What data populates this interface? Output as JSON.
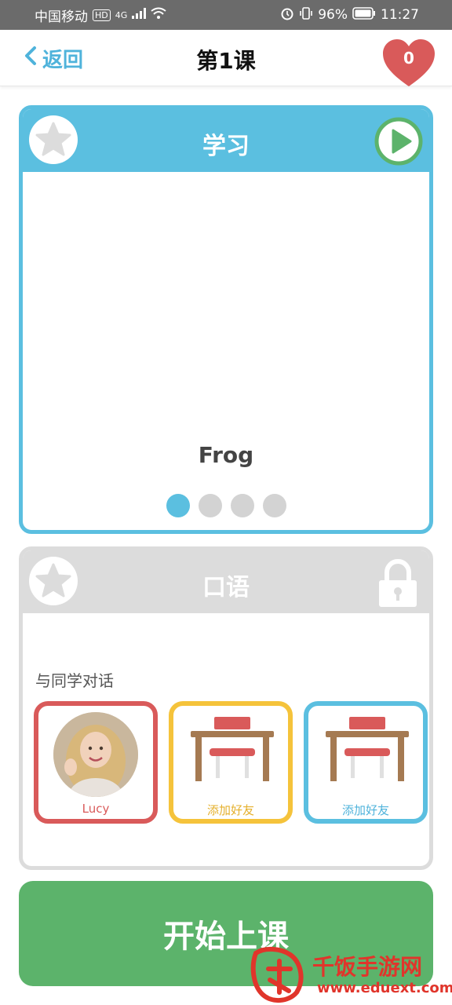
{
  "status_bar": {
    "carrier": "中国移动",
    "hd": "HD",
    "network": "4G",
    "battery": "96%",
    "time": "11:27"
  },
  "nav": {
    "back_label": "返回",
    "title": "第1课",
    "hearts": "0"
  },
  "learn_card": {
    "title": "学习",
    "word": "Frog",
    "page_count": 4,
    "active_page": 1
  },
  "speak_card": {
    "title": "口语",
    "section_label": "与同学对话",
    "friends": [
      {
        "name": "Lucy",
        "type": "avatar",
        "color": "#d95a5a"
      },
      {
        "name": "添加好友",
        "type": "empty",
        "color": "#f5c33b"
      },
      {
        "name": "添加好友",
        "type": "empty",
        "color": "#5bbfe0"
      }
    ]
  },
  "start_button": {
    "label": "开始上课"
  },
  "watermark": {
    "brand": "千饭手游网",
    "url": "www.eduext.com"
  },
  "colors": {
    "primary_blue": "#5bbfe0",
    "green": "#5cb36b",
    "heart_red": "#d95a5a",
    "yellow": "#f5c33b",
    "locked_gray": "#dcdcdc"
  },
  "icons": [
    "signal-icon",
    "wifi-icon",
    "alarm-icon",
    "vibrate-icon",
    "battery-icon",
    "back-chevron-icon",
    "heart-icon",
    "star-icon",
    "play-icon",
    "lock-icon",
    "desk-icon"
  ]
}
